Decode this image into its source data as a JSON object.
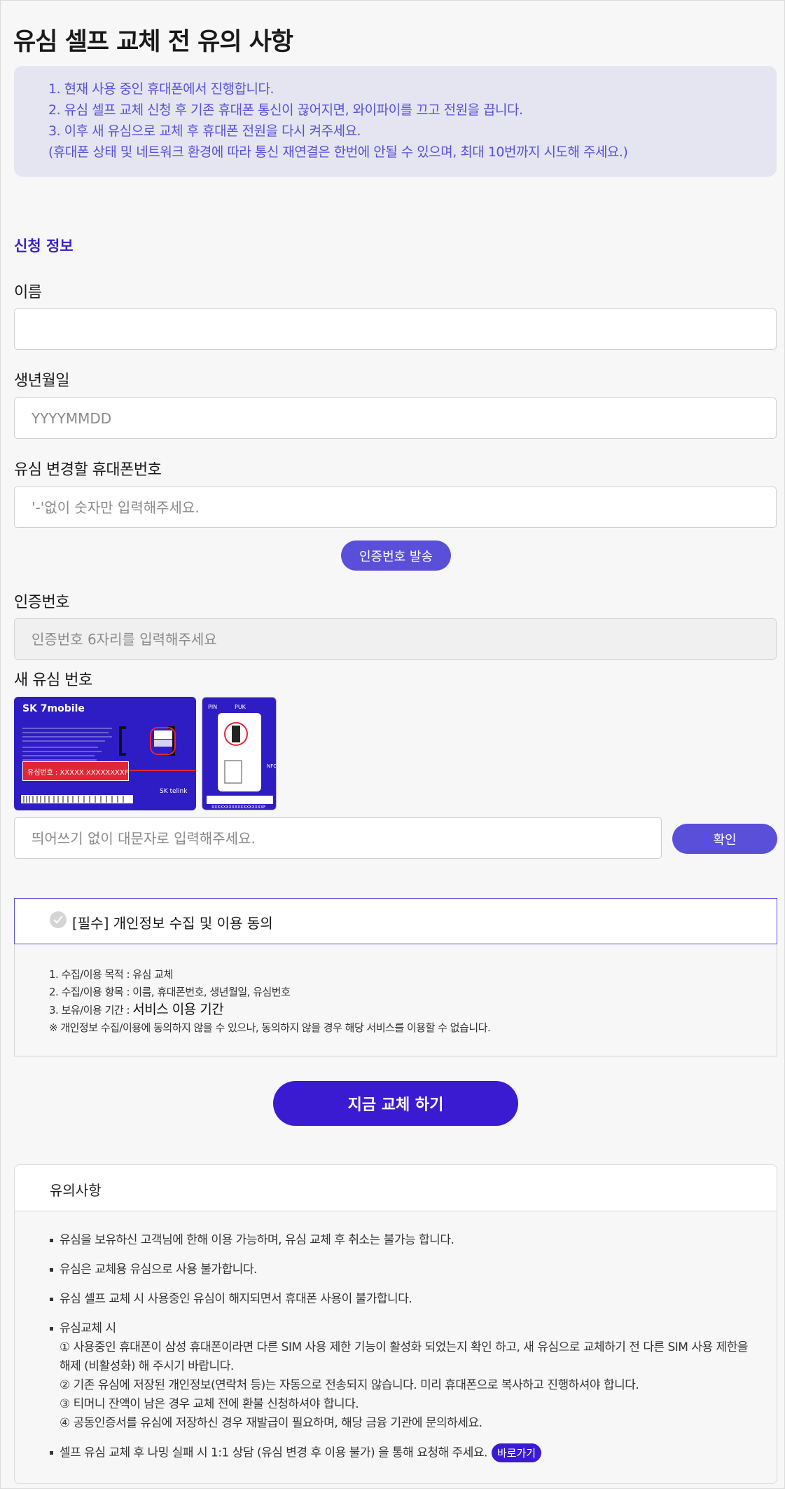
{
  "page": {
    "title": "유심 셀프 교체 전 유의 사항"
  },
  "notice": [
    "1. 현재 사용 중인 휴대폰에서 진행합니다.",
    "2. 유심 셀프 교체 신청 후 기존 휴대폰 통신이 끊어지면, 와이파이를 끄고 전원을 끕니다.",
    "3. 이후 새 유심으로 교체 후 휴대폰 전원을 다시 켜주세요.",
    "(휴대폰 상태 및 네트워크 환경에 따라 통신 재연결은 한번에 안될 수 있으며, 최대 10번까지 시도해 주세요.)"
  ],
  "form": {
    "section_title": "신청 정보",
    "name_label": "이름",
    "name_value": "",
    "birth_label": "생년월일",
    "birth_placeholder": "YYYYMMDD",
    "phone_label": "유심 변경할 휴대폰번호",
    "phone_placeholder": "'-'없이 숫자만 입력해주세요.",
    "auth_send_button": "인증번호 발송",
    "auth_label": "인증번호",
    "auth_placeholder": "인증번호 6자리를 입력해주세요",
    "sim_label": "새 유심 번호",
    "sim_placeholder": "띄어쓰기 없이 대문자로 입력해주세요.",
    "confirm_button": "확인"
  },
  "sim_image": {
    "brand": "SK 7mobile",
    "serial_label": "유심번호 : XXXXX XXXXXXXXF",
    "telink": "SK telink",
    "pin": "PIN",
    "puk": "PUK",
    "nfc": "NFC",
    "barcode_text": "XXXXXXXXXXXXXXXXXXF"
  },
  "consent": {
    "title": "[필수] 개인정보 수집 및 이용 동의",
    "purpose": "1. 수집/이용 목적 : 유심 교체",
    "items": "2. 수집/이용 항목 : 이름, 휴대폰번호, 생년월일, 유심번호",
    "period_prefix": "3. 보유/이용 기간 : ",
    "period_value": "서비스 이용 기간",
    "note": "※ 개인정보 수집/이용에 동의하지 않을 수 있으나, 동의하지 않을 경우 해당 서비스를 이용할 수 없습니다."
  },
  "submit_button": "지금 교체 하기",
  "caution": {
    "title": "유의사항",
    "item1": "유심을 보유하신 고객님에 한해 이용 가능하며, 유심 교체 후 취소는 불가능 합니다.",
    "item2": "유심은 교체용 유심으로 사용 불가합니다.",
    "item3": "유심 셀프 교체 시 사용중인 유심이 해지되면서 휴대폰 사용이 불가합니다.",
    "item4_title": "유심교체 시",
    "item4_sub1": "① 사용중인 휴대폰이 삼성 휴대폰이라면 다른 SIM 사용 제한 기능이 활성화 되었는지 확인 하고, 새 유심으로 교체하기 전 다른 SIM 사용 제한을 해제 (비활성화) 해 주시기 바랍니다.",
    "item4_sub2": "② 기존 유심에 저장된 개인정보(연락처 등)는 자동으로 전송되지 않습니다. 미리 휴대폰으로 복사하고 진행하셔야 합니다.",
    "item4_sub3": "③ 티머니 잔액이 남은 경우 교체 전에 환불 신청하셔야 합니다.",
    "item4_sub4": "④ 공동인증서를 유심에 저장하신 경우 재발급이 필요하며, 해당 금융 기관에 문의하세요.",
    "item5": "셀프 유심 교체 후 나밍 실패 시 1:1 상담 (유심 변경 후 이용 불가) 을 통해 요청해 주세요.",
    "go_button": "바로가기"
  }
}
